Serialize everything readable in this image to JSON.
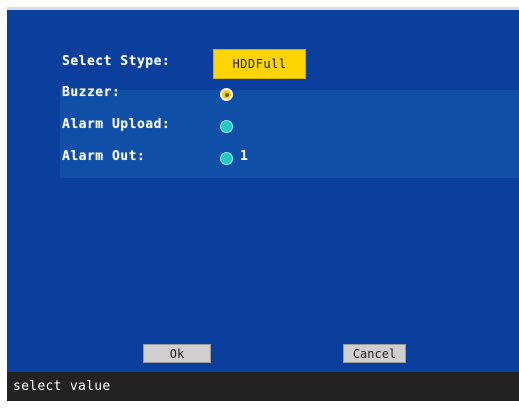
{
  "form": {
    "stype_label": "Select Stype:",
    "stype_value": "HDDFull",
    "buzzer_label": "Buzzer:",
    "alarm_upload_label": "Alarm Upload:",
    "alarm_out_label": "Alarm Out:",
    "alarm_out_value": "1"
  },
  "buttons": {
    "ok": "Ok",
    "cancel": "Cancel"
  },
  "status": {
    "text": "select value"
  },
  "colors": {
    "dialog_background": "#0a3f9e",
    "select_highlight": "#ffd400",
    "radio_cyan": "#24c8c8",
    "status_bar": "#222222"
  }
}
